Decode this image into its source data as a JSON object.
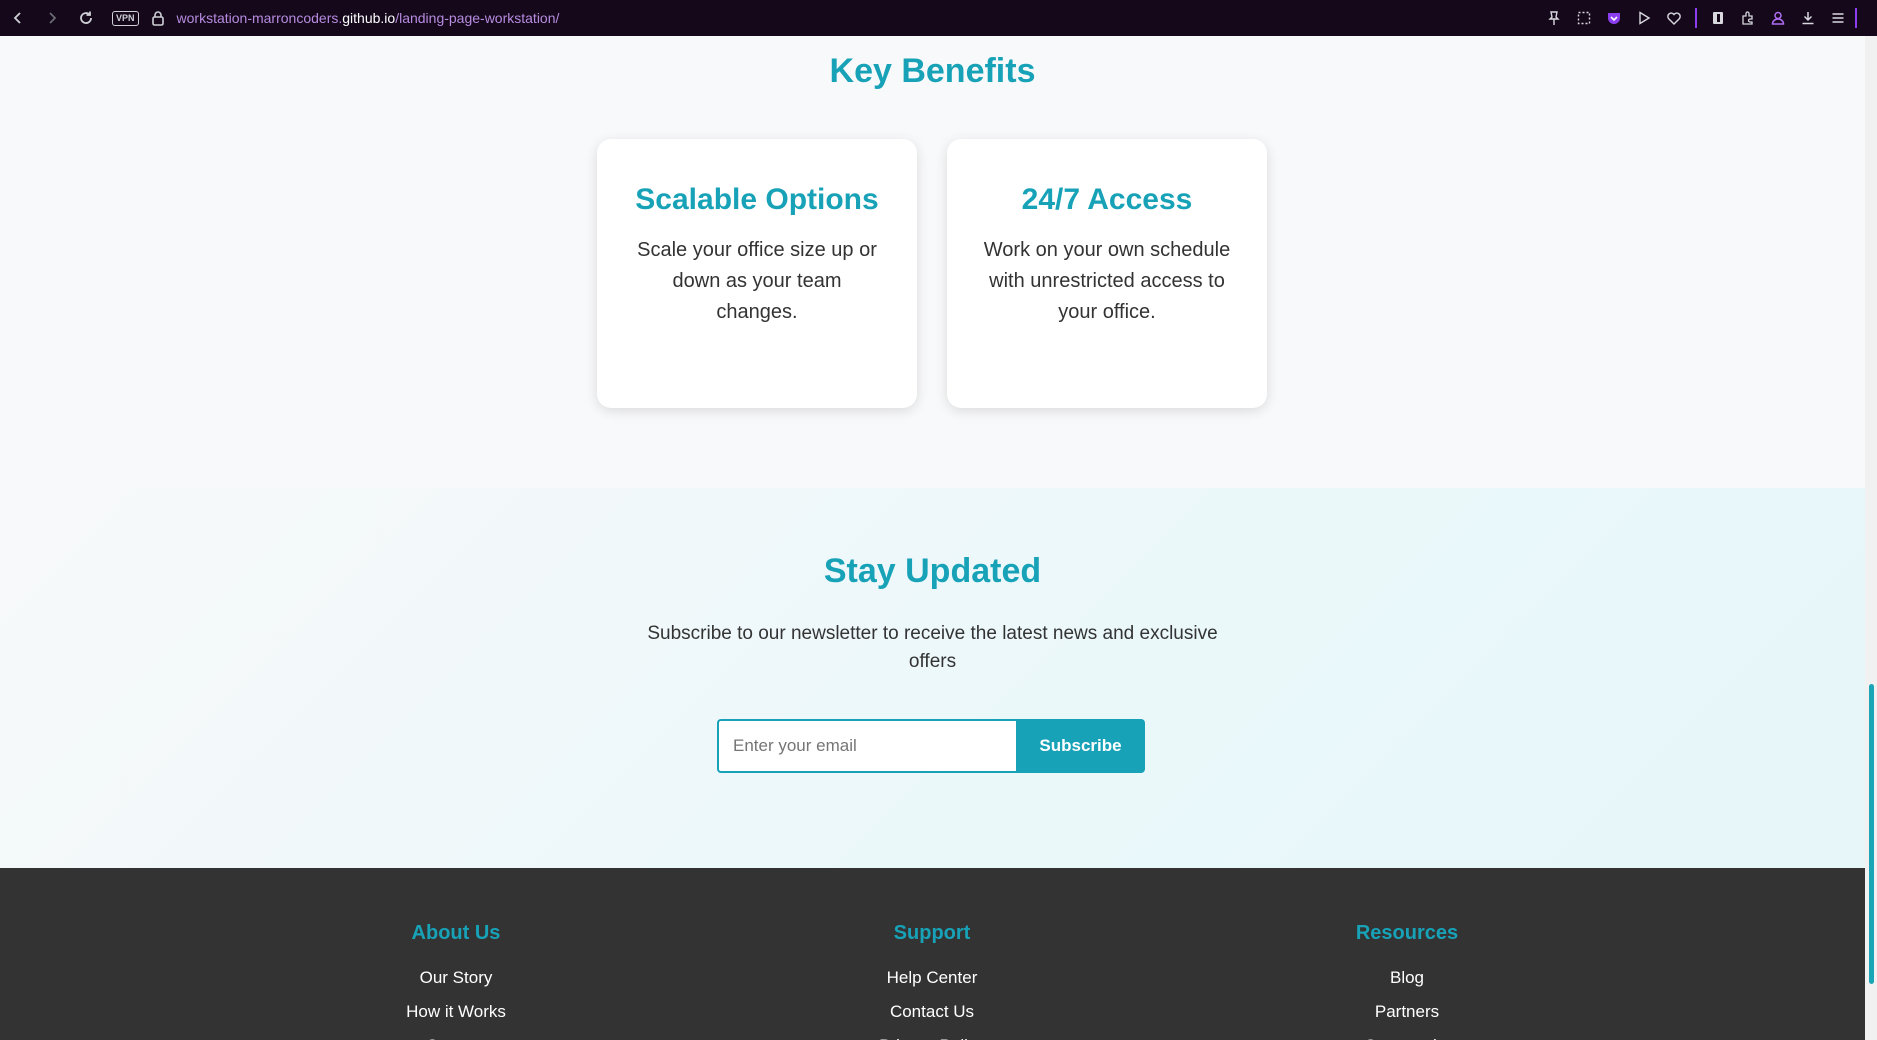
{
  "browser": {
    "vpn_label": "VPN",
    "url_prefix": "workstation-marroncoders.",
    "url_host": "github.io",
    "url_path": "/landing-page-workstation/"
  },
  "benefits": {
    "title": "Key Benefits",
    "cards": [
      {
        "title": "Scalable Options",
        "text": "Scale your office size up or down as your team changes."
      },
      {
        "title": "24/7 Access",
        "text": "Work on your own schedule with unrestricted access to your office."
      }
    ]
  },
  "newsletter": {
    "title": "Stay Updated",
    "subtitle": "Subscribe to our newsletter to receive the latest news and exclusive offers",
    "email_placeholder": "Enter your email",
    "subscribe_label": "Subscribe"
  },
  "footer": {
    "columns": [
      {
        "title": "About Us",
        "links": [
          "Our Story",
          "How it Works",
          "Careers"
        ]
      },
      {
        "title": "Support",
        "links": [
          "Help Center",
          "Contact Us",
          "Privacy Policy"
        ]
      },
      {
        "title": "Resources",
        "links": [
          "Blog",
          "Partners",
          "Community"
        ]
      }
    ]
  },
  "colors": {
    "accent": "#17a2b8",
    "footer_bg": "#333333",
    "browser_bg": "#14081a"
  }
}
